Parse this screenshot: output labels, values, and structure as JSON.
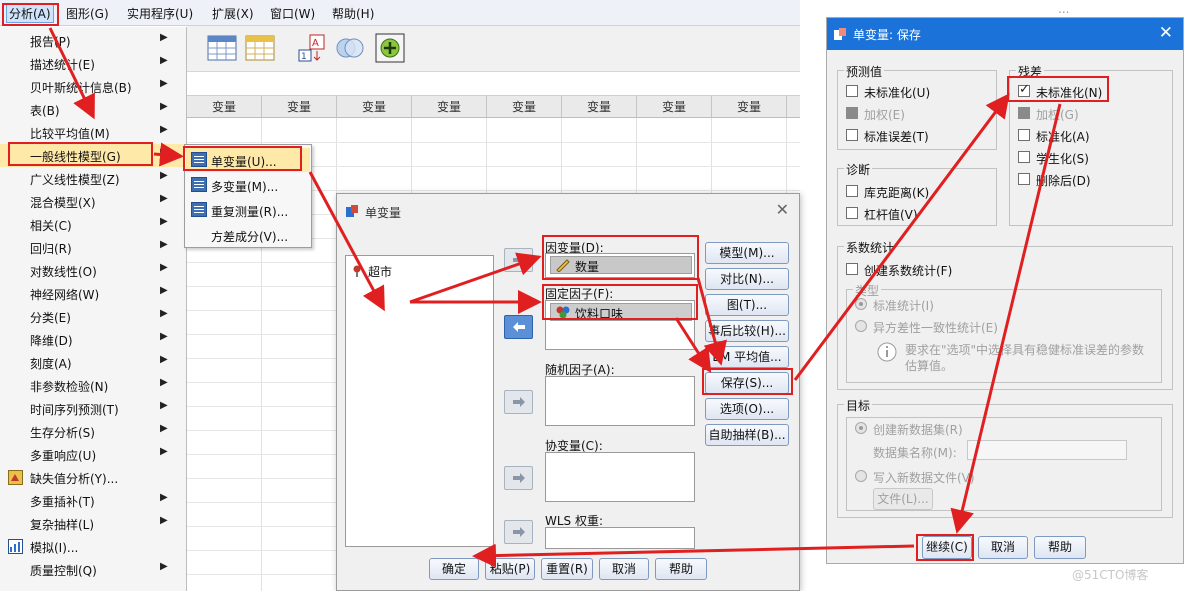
{
  "menubar": {
    "items": [
      "分析(A)",
      "图形(G)",
      "实用程序(U)",
      "扩展(X)",
      "窗口(W)",
      "帮助(H)"
    ]
  },
  "analyze_menu": {
    "items": [
      {
        "label": "报告(P)",
        "submenu": true
      },
      {
        "label": "描述统计(E)",
        "submenu": true
      },
      {
        "label": "贝叶斯统计信息(B)",
        "submenu": true
      },
      {
        "label": "表(B)",
        "submenu": true
      },
      {
        "label": "比较平均值(M)",
        "submenu": true
      },
      {
        "label": "一般线性模型(G)",
        "submenu": true
      },
      {
        "label": "广义线性模型(Z)",
        "submenu": true
      },
      {
        "label": "混合模型(X)",
        "submenu": true
      },
      {
        "label": "相关(C)",
        "submenu": true
      },
      {
        "label": "回归(R)",
        "submenu": true
      },
      {
        "label": "对数线性(O)",
        "submenu": true
      },
      {
        "label": "神经网络(W)",
        "submenu": true
      },
      {
        "label": "分类(E)",
        "submenu": true
      },
      {
        "label": "降维(D)",
        "submenu": true
      },
      {
        "label": "刻度(A)",
        "submenu": true
      },
      {
        "label": "非参数检验(N)",
        "submenu": true
      },
      {
        "label": "时间序列预测(T)",
        "submenu": true
      },
      {
        "label": "生存分析(S)",
        "submenu": true
      },
      {
        "label": "多重响应(U)",
        "submenu": true
      },
      {
        "label": "缺失值分析(Y)...",
        "submenu": false
      },
      {
        "label": "多重插补(T)",
        "submenu": true
      },
      {
        "label": "复杂抽样(L)",
        "submenu": true
      },
      {
        "label": "模拟(I)...",
        "submenu": false
      },
      {
        "label": "质量控制(Q)",
        "submenu": true
      }
    ]
  },
  "glm_submenu": {
    "items": [
      "单变量(U)...",
      "多变量(M)...",
      "重复测量(R)...",
      "方差成分(V)..."
    ]
  },
  "grid": {
    "column_header": "变量"
  },
  "univariate": {
    "title": "单变量",
    "source_variable": "超市",
    "dependent_label": "因变量(D):",
    "dependent_value": "数量",
    "fixed_label": "固定因子(F):",
    "fixed_value": "饮料口味",
    "random_label": "随机因子(A):",
    "covariate_label": "协变量(C):",
    "wls_label": "WLS 权重:",
    "side_buttons": [
      "模型(M)...",
      "对比(N)...",
      "图(T)...",
      "事后比较(H)...",
      "EM 平均值...",
      "保存(S)...",
      "选项(O)...",
      "自助抽样(B)..."
    ],
    "bottom_buttons": [
      "确定",
      "粘贴(P)",
      "重置(R)",
      "取消",
      "帮助"
    ]
  },
  "save_dialog": {
    "title": "单变量: 保存",
    "predicted": {
      "title": "预测值",
      "items": [
        {
          "label": "未标准化(U)",
          "checked": false,
          "disabled": false
        },
        {
          "label": "加权(E)",
          "checked": false,
          "disabled": true
        },
        {
          "label": "标准误差(T)",
          "checked": false,
          "disabled": false
        }
      ]
    },
    "residuals": {
      "title": "残差",
      "items": [
        {
          "label": "未标准化(N)",
          "checked": true,
          "disabled": false
        },
        {
          "label": "加权(G)",
          "checked": false,
          "disabled": true
        },
        {
          "label": "标准化(A)",
          "checked": false,
          "disabled": false
        },
        {
          "label": "学生化(S)",
          "checked": false,
          "disabled": false
        },
        {
          "label": "删除后(D)",
          "checked": false,
          "disabled": false
        }
      ]
    },
    "diagnostics": {
      "title": "诊断",
      "items": [
        {
          "label": "库克距离(K)",
          "checked": false
        },
        {
          "label": "杠杆值(V)",
          "checked": false
        }
      ]
    },
    "coef_stats": {
      "title": "系数统计",
      "create_label": "创建系数统计(F)",
      "type_title": "类型",
      "type_standard": "标准统计(I)",
      "type_hetero": "异方差性一致性统计(E)",
      "info_text": "要求在\"选项\"中选择具有稳健标准误差的参数估算值。"
    },
    "target": {
      "title": "目标",
      "new_dataset": "创建新数据集(R)",
      "dataset_name_label": "数据集名称(M):",
      "write_file": "写入新数据文件(V)",
      "file_button": "文件(L)..."
    },
    "buttons": [
      "继续(C)",
      "取消",
      "帮助"
    ]
  },
  "watermark": "@51CTO博客",
  "colors": {
    "highlight_red": "#e02020",
    "title_blue": "#1b73d9",
    "menu_highlight": "#ffe9a8"
  }
}
